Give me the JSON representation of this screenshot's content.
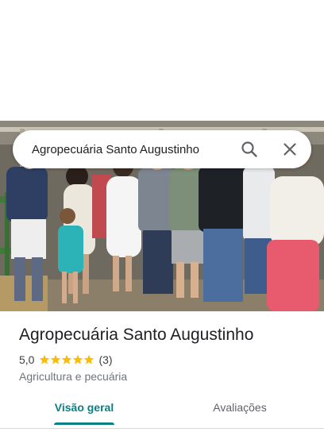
{
  "search": {
    "query": "Agropecuária Santo Augustinho"
  },
  "place": {
    "name": "Agropecuária Santo Augustinho",
    "rating": "5,0",
    "stars": 5,
    "reviews_count": "(3)",
    "category": "Agricultura e pecuária"
  },
  "tabs": [
    {
      "label": "Visão geral",
      "active": true
    },
    {
      "label": "Avaliações",
      "active": false
    }
  ],
  "colors": {
    "accent": "#0b7f86",
    "star": "#fbbc04"
  }
}
